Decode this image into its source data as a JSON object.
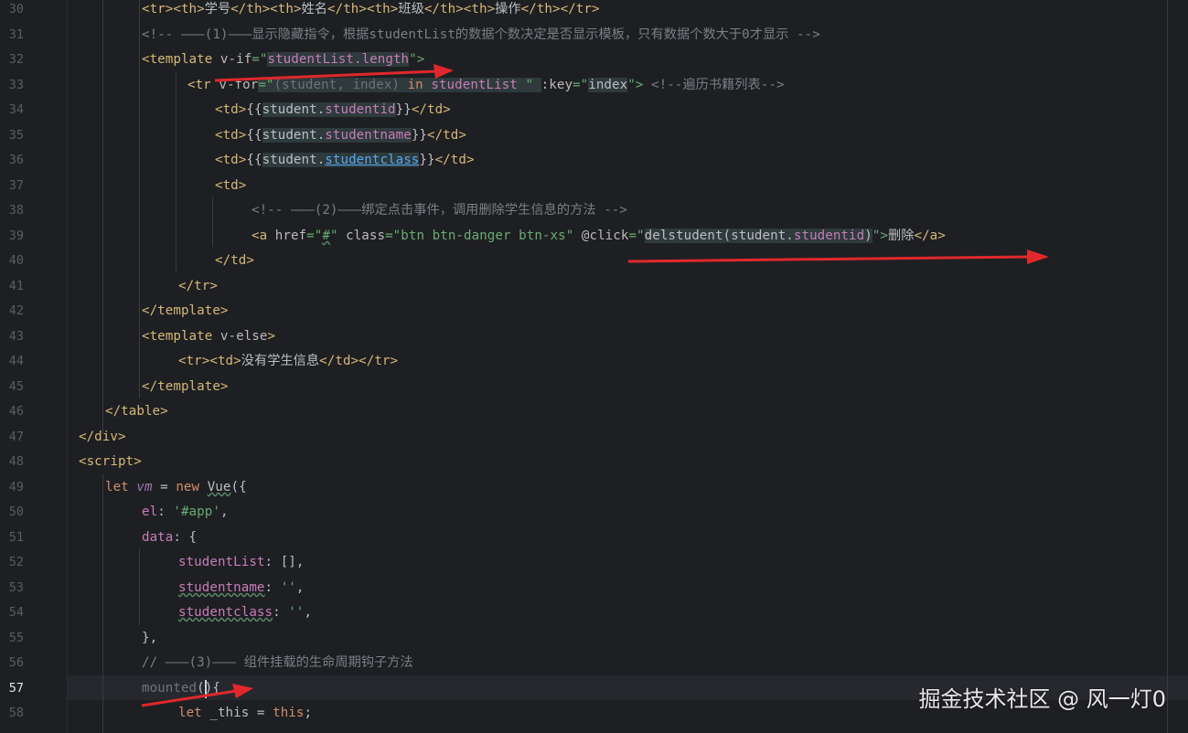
{
  "editor": {
    "line_numbers": [
      "30",
      "31",
      "32",
      "33",
      "34",
      "35",
      "36",
      "37",
      "38",
      "39",
      "40",
      "41",
      "42",
      "43",
      "44",
      "45",
      "46",
      "47",
      "48",
      "49",
      "50",
      "51",
      "52",
      "53",
      "54",
      "55",
      "56",
      "57",
      "58"
    ],
    "current_line": "57"
  },
  "code": {
    "l30": [
      "<tr><th>",
      "学号",
      "</th><th>",
      "姓名",
      "</th><th>",
      "班级",
      "</th><th>",
      "操作",
      "</th></tr>"
    ],
    "l31": "<!-- ———(1)———显示隐藏指令，根据studentList的数据个数决定是否显示模板，只有数据个数大于0才显示 -->",
    "l32": [
      "<template ",
      "v-if",
      "=\"",
      "studentList.length",
      "\">"
    ],
    "l33": [
      "<tr ",
      "v-for",
      "=\"",
      "(student, index)",
      " in ",
      "studentList ",
      "\" ",
      ":key",
      "=\"",
      "index",
      "\">",
      " <!--遍历书籍列表-->"
    ],
    "l34": [
      "<td>",
      "{{",
      "student.",
      "studentid",
      "}}",
      "</td>"
    ],
    "l35": [
      "<td>",
      "{{",
      "student.",
      "studentname",
      "}}",
      "</td>"
    ],
    "l36": [
      "<td>",
      "{{",
      "student.",
      "studentclass",
      "}}",
      "</td>"
    ],
    "l37": "<td>",
    "l38": "<!-- ———(2)———绑定点击事件，调用删除学生信息的方法 -->",
    "l39": [
      "<a ",
      "href",
      "=\"",
      "#",
      "\" ",
      "class",
      "=\"btn btn-danger btn-xs\" ",
      "@click",
      "=\"",
      "delstudent(student.",
      "studentid",
      ")",
      "\">",
      "删除",
      "</a>"
    ],
    "l40": "</td>",
    "l41": "</tr>",
    "l42": "</template>",
    "l43": [
      "<template ",
      "v-else",
      ">"
    ],
    "l44": [
      "<tr><td>",
      "没有学生信息",
      "</td></tr>"
    ],
    "l45": "</template>",
    "l46": "</table>",
    "l47": "</div>",
    "l48": "<script>",
    "l49": [
      "let ",
      "vm",
      " = ",
      "new ",
      "Vue",
      "({"
    ],
    "l50": [
      "el",
      ": ",
      "'#app'",
      ","
    ],
    "l51": [
      "data",
      ": {"
    ],
    "l52": [
      "studentList",
      ": [],"
    ],
    "l53": [
      "studentname",
      ": ",
      "''",
      ","
    ],
    "l54": [
      "studentclass",
      ": ",
      "''",
      ","
    ],
    "l55": "},",
    "l56": "// ———(3)——— 组件挂载的生命周期钩子方法",
    "l57": [
      "mounted",
      "(){"
    ],
    "l58": [
      "let ",
      "_this",
      " = ",
      "this",
      ";"
    ]
  },
  "watermark": "掘金技术社区 @ 风一灯0",
  "colors": {
    "background": "#1e1f22",
    "tag": "#d5b778",
    "string": "#6aab73",
    "comment": "#7a7e85",
    "keyword": "#cf8e6d",
    "property": "#c77dbb",
    "arrow": "#e0282c"
  }
}
